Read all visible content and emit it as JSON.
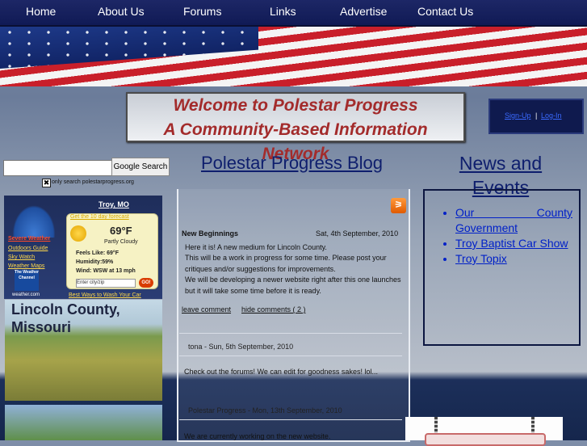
{
  "nav": {
    "items": [
      "Home",
      "About Us",
      "Forums",
      "Links",
      "Advertise",
      "Contact Us"
    ]
  },
  "welcome": {
    "line1": "Welcome to Polestar Progress",
    "line2": "A Community-Based Information",
    "line3": "Network"
  },
  "account": {
    "signup": "Sign-Up",
    "sep": "|",
    "login": "Log-In"
  },
  "search": {
    "value": "",
    "button": "Google Search",
    "checkbox_mark": "✖",
    "option_label": "only search polestarprogress.org"
  },
  "weather": {
    "location": "Troy, MO",
    "forecast_link": "Get the 10 day forecast",
    "temperature": "69°F",
    "condition": "Partly Cloudy",
    "feels_like": "Feels Like: 69°F",
    "humidity": "Humidity:59%",
    "wind": "Wind: WSW at 13 mph",
    "city_placeholder": "Enter city/zip",
    "go": "GO!",
    "best_link": "Best Ways to Wash Your Car",
    "links": [
      "Severe Weather",
      "Outdoors Guide",
      "Sky Watch",
      "Weather Maps"
    ],
    "brand": "The Weather Channel",
    "brand_site": "weather.com"
  },
  "sidebar": {
    "photo_title_1": "Lincoln County,",
    "photo_title_2": "Missouri"
  },
  "blog": {
    "heading": "Polestar Progress Blog",
    "post": {
      "title": "New Beginnings",
      "date": "Sat, 4th September, 2010",
      "body": [
        "Here it is! A new medium for Lincoln County.",
        "This will be a work in progress for some time. Please post your critiques and/or suggestions for improvements.",
        "We will be developing a newer website right after this one launches but it will take some time before it is ready."
      ],
      "leave_comment": "leave comment",
      "hide_comments": "hide comments ( 2 )"
    },
    "comments": [
      {
        "meta": "tona - Sun, 5th September, 2010",
        "text": "Check out the forums! We can edit for goodness sakes! lol..."
      },
      {
        "meta": "Polestar Progress - Mon, 13th September, 2010",
        "text": "We are currently working on the new website."
      }
    ]
  },
  "news": {
    "heading": "News and Events",
    "items": [
      "Our County Government",
      "Troy Baptist Car Show",
      "Troy Topix"
    ]
  }
}
